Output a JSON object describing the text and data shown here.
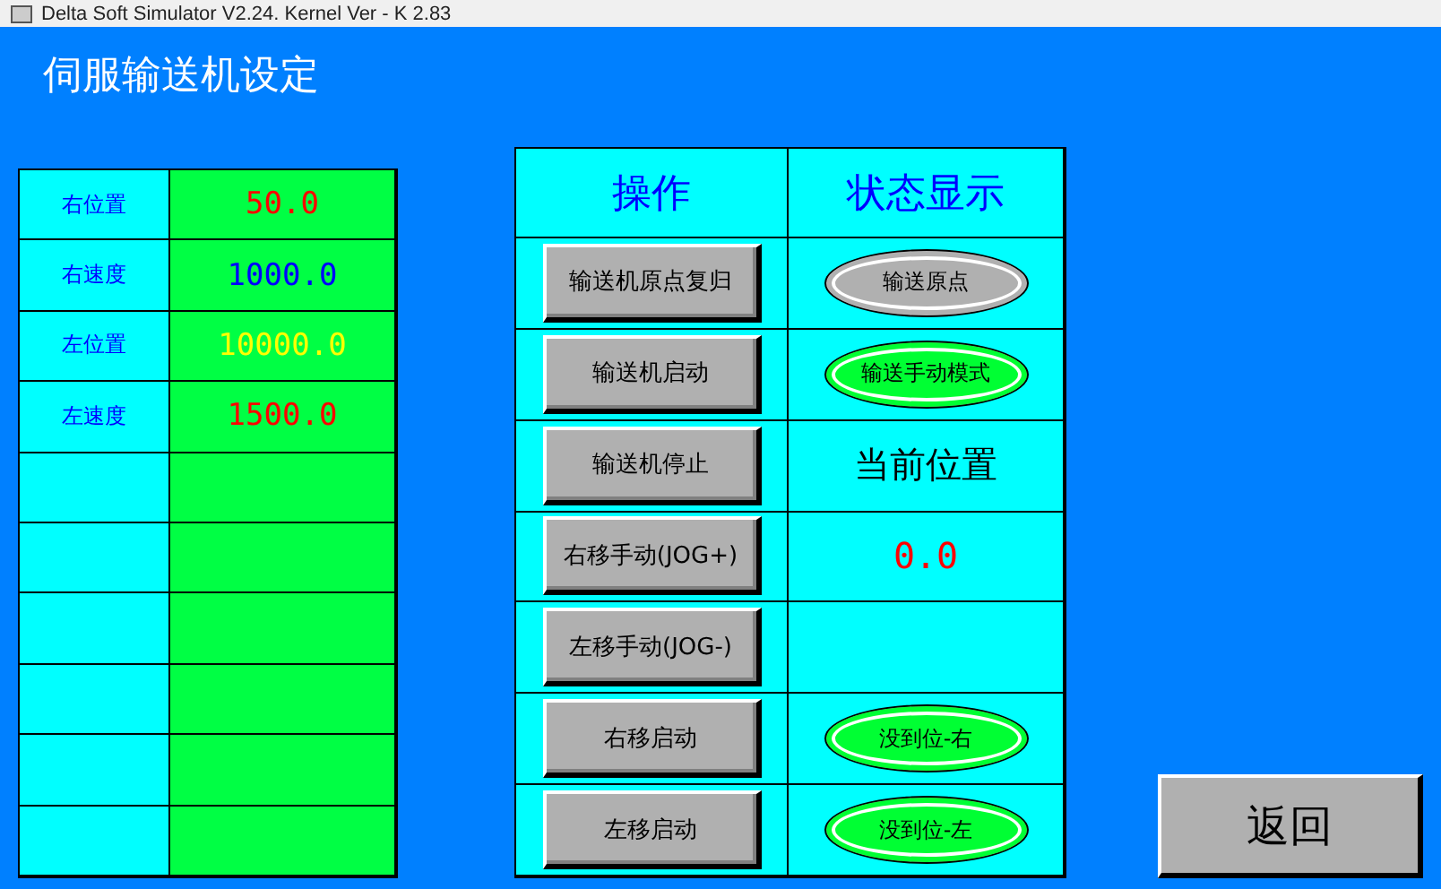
{
  "window": {
    "title": "Delta Soft Simulator V2.24. Kernel Ver - K 2.83"
  },
  "screen_title": "伺服输送机设定",
  "parameters": [
    {
      "label": "右位置",
      "value": "50.0",
      "color": "#ff0000"
    },
    {
      "label": "右速度",
      "value": "1000.0",
      "color": "#0000ff"
    },
    {
      "label": "左位置",
      "value": "10000.0",
      "color": "#ffff00"
    },
    {
      "label": "左速度",
      "value": "1500.0",
      "color": "#ff0000"
    }
  ],
  "control_table": {
    "headers": [
      "操作",
      "状态显示"
    ],
    "rows": [
      {
        "button": "输送机原点复归",
        "status": {
          "kind": "lamp",
          "text": "输送原点",
          "on": false
        }
      },
      {
        "button": "输送机启动",
        "status": {
          "kind": "lamp",
          "text": "输送手动模式",
          "on": true
        }
      },
      {
        "button": "输送机停止",
        "status": {
          "kind": "label",
          "text": "当前位置"
        }
      },
      {
        "button": "右移手动(JOG+)",
        "status": {
          "kind": "reading",
          "text": "0.0"
        }
      },
      {
        "button": "左移手动(JOG-)"
      },
      {
        "button": "右移启动",
        "status": {
          "kind": "lamp",
          "text": "没到位-右",
          "on": true
        }
      },
      {
        "button": "左移启动",
        "status": {
          "kind": "lamp",
          "text": "没到位-左",
          "on": true
        }
      }
    ]
  },
  "return_button": "返回"
}
